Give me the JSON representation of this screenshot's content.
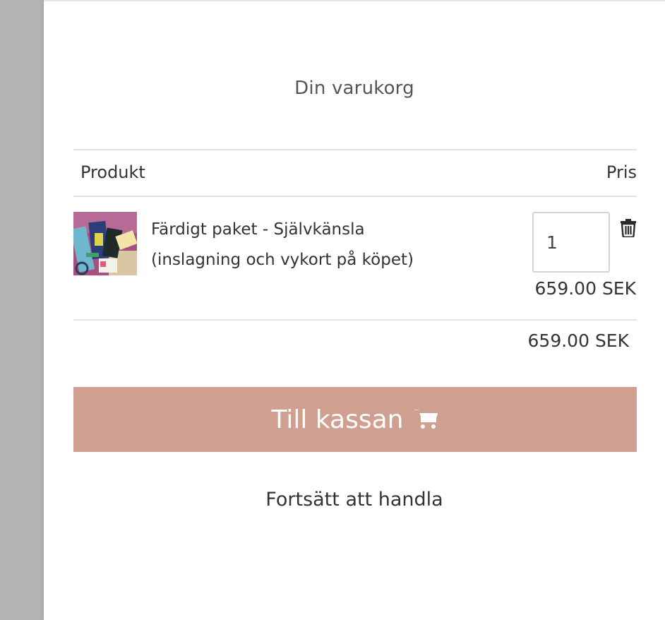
{
  "cart": {
    "title": "Din varukorg",
    "columns": {
      "product": "Produkt",
      "price": "Pris"
    },
    "items": [
      {
        "name_line1": "Färdigt paket - Självkänsla",
        "name_line2": "(inslagning och vykort på köpet)",
        "quantity": "1",
        "price": "659.00 SEK"
      }
    ],
    "total": "659.00 SEK",
    "checkout_label": "Till kassan",
    "continue_label": "Fortsätt att handla"
  },
  "colors": {
    "backdrop": "#b3b3b1",
    "checkout_button": "#cf9f90",
    "divider": "#e3e3e3"
  },
  "icons": {
    "trash": "trash-icon",
    "cart": "cart-icon"
  }
}
